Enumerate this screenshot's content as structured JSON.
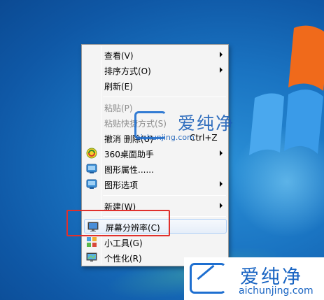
{
  "desktop": {
    "background": "#1a74c2"
  },
  "context_menu": {
    "items": [
      {
        "label": "查看(V)",
        "submenu": true,
        "disabled": false
      },
      {
        "label": "排序方式(O)",
        "submenu": true,
        "disabled": false
      },
      {
        "label": "刷新(E)",
        "submenu": false,
        "disabled": false
      },
      {
        "label": "粘贴(P)",
        "submenu": false,
        "disabled": true
      },
      {
        "label": "粘贴快捷方式(S)",
        "submenu": false,
        "disabled": true
      },
      {
        "label": "撤消 删除(U)",
        "shortcut": "Ctrl+Z",
        "submenu": false,
        "disabled": false
      },
      {
        "label": "360桌面助手",
        "submenu": true,
        "disabled": false,
        "icon": "360-desktop-icon"
      },
      {
        "label": "图形属性......",
        "submenu": false,
        "disabled": false,
        "icon": "graphics-properties-icon"
      },
      {
        "label": "图形选项",
        "submenu": true,
        "disabled": false,
        "icon": "graphics-options-icon"
      },
      {
        "label": "新建(W)",
        "submenu": true,
        "disabled": false
      },
      {
        "label": "屏幕分辨率(C)",
        "submenu": false,
        "disabled": false,
        "icon": "screen-resolution-icon",
        "highlighted": true
      },
      {
        "label": "小工具(G)",
        "submenu": false,
        "disabled": false,
        "icon": "gadgets-icon"
      },
      {
        "label": "个性化(R)",
        "submenu": false,
        "disabled": false,
        "icon": "personalize-icon"
      }
    ]
  },
  "watermark": {
    "title": "爱纯净",
    "url": "aichunjing.com"
  },
  "brand": {
    "title": "爱纯净",
    "url": "aichunjing.com"
  },
  "colors": {
    "accent_red": "#e0302c",
    "brand_blue": "#1763c2"
  }
}
